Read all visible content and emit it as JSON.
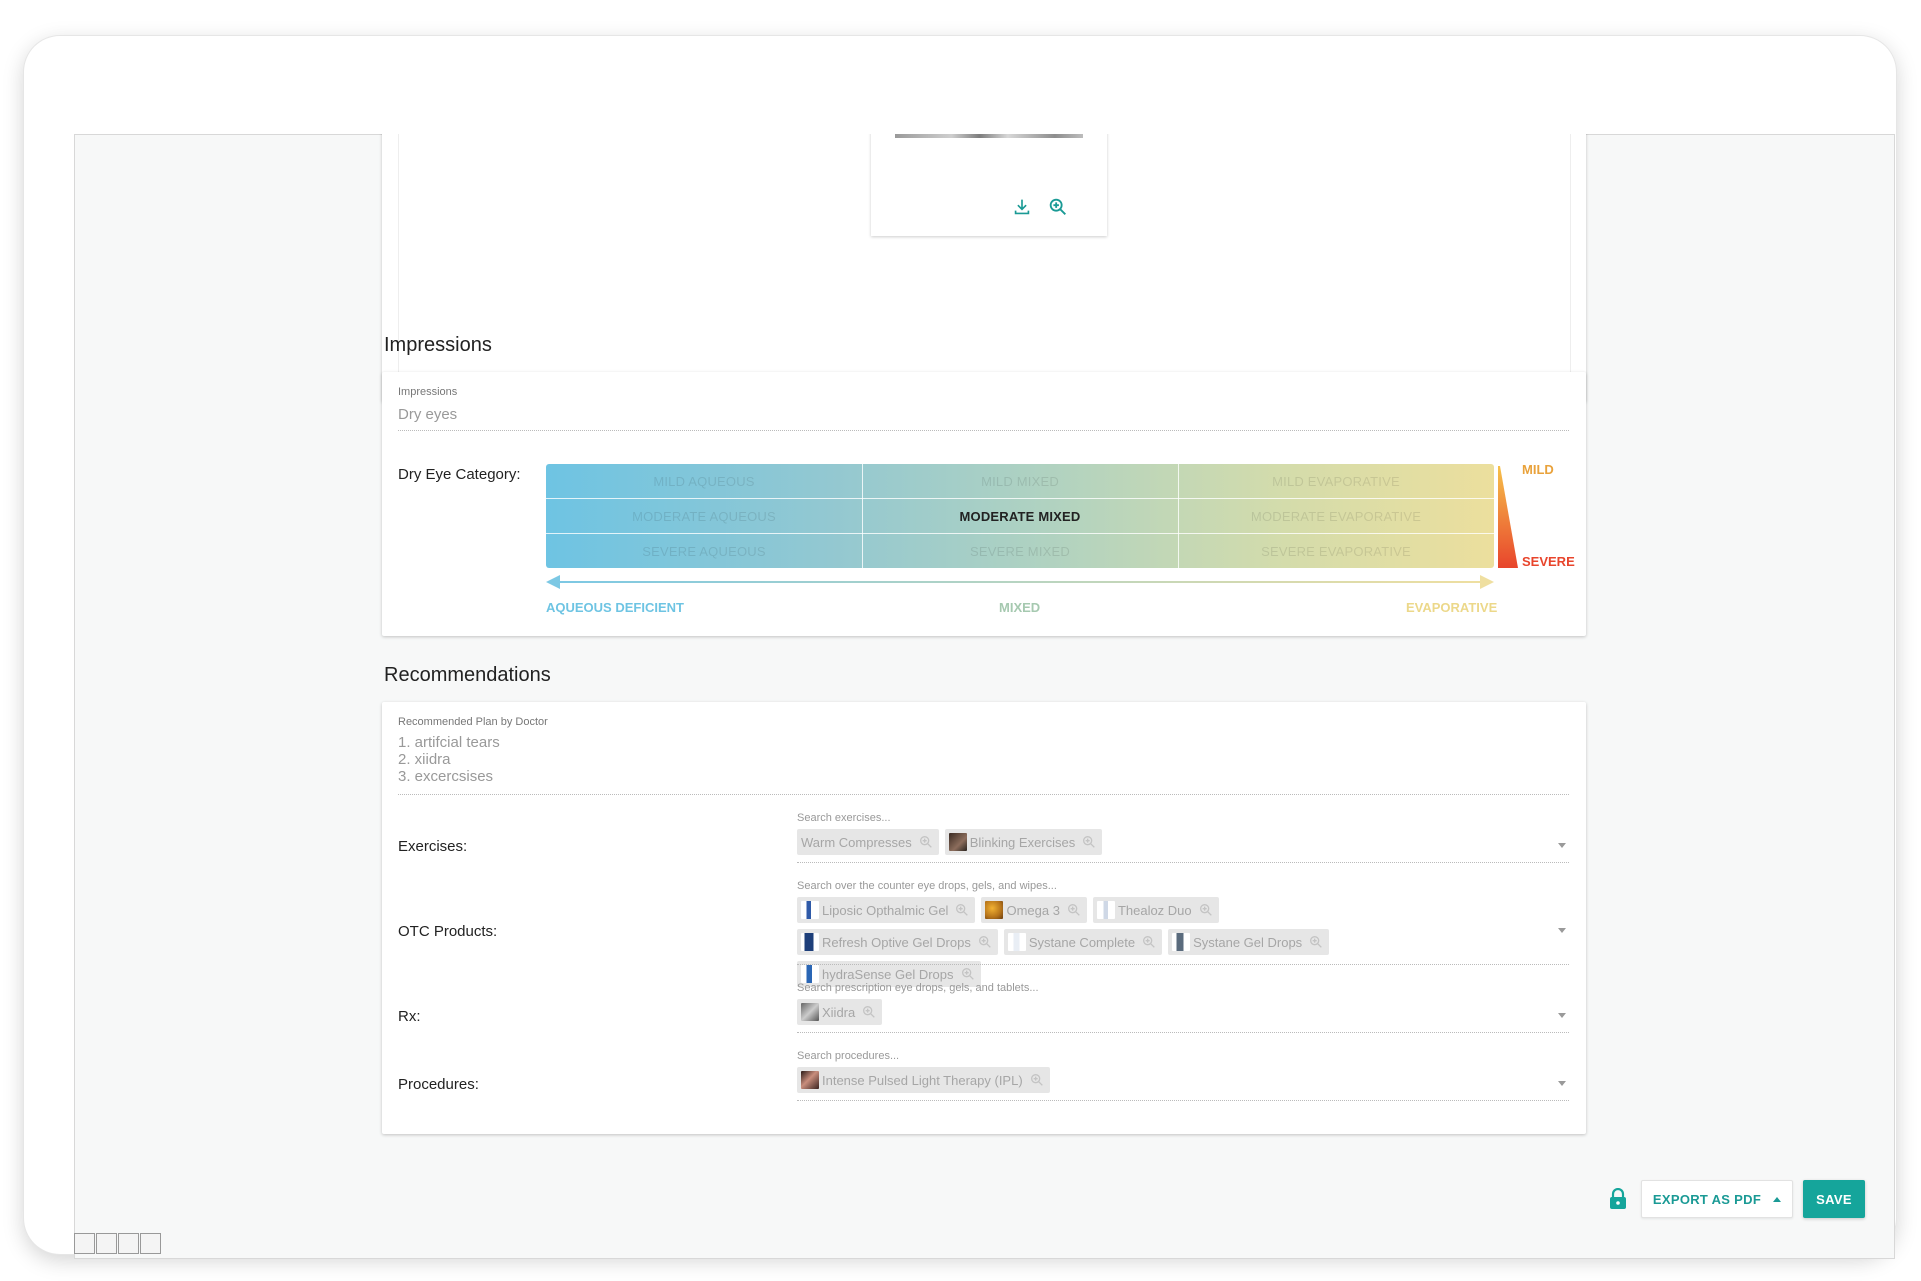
{
  "impressions": {
    "section_title": "Impressions",
    "field_label": "Impressions",
    "field_value": "Dry eyes",
    "category_label": "Dry Eye Category:",
    "grid": {
      "rows": [
        [
          "MILD AQUEOUS",
          "MILD MIXED",
          "MILD EVAPORATIVE"
        ],
        [
          "MODERATE AQUEOUS",
          "MODERATE MIXED",
          "MODERATE EVAPORATIVE"
        ],
        [
          "SEVERE AQUEOUS",
          "SEVERE MIXED",
          "SEVERE EVAPORATIVE"
        ]
      ],
      "selected": "MODERATE MIXED"
    },
    "axis": {
      "left": "AQUEOUS DEFICIENT",
      "middle": "MIXED",
      "right": "EVAPORATIVE"
    },
    "severity": {
      "top": "MILD",
      "bottom": "SEVERE"
    }
  },
  "recommendations": {
    "section_title": "Recommendations",
    "plan_label": "Recommended Plan by Doctor",
    "plan_lines": [
      "1. artifcial tears",
      "2. xiidra",
      "3. excercsises"
    ],
    "exercises": {
      "label": "Exercises:",
      "placeholder": "Search exercises...",
      "chips": [
        "Warm Compresses",
        "Blinking Exercises"
      ]
    },
    "otc": {
      "label": "OTC Products:",
      "placeholder": "Search over the counter eye drops, gels, and wipes...",
      "chips": [
        "Liposic Opthalmic Gel",
        "Omega 3",
        "Thealoz Duo",
        "Refresh Optive Gel Drops",
        "Systane Complete",
        "Systane Gel Drops",
        "hydraSense Gel Drops"
      ]
    },
    "rx": {
      "label": "Rx:",
      "placeholder": "Search prescription eye drops, gels, and tablets...",
      "chips": [
        "Xiidra"
      ]
    },
    "procedures": {
      "label": "Procedures:",
      "placeholder": "Search procedures...",
      "chips": [
        "Intense Pulsed Light Therapy (IPL)"
      ]
    }
  },
  "footer": {
    "export_label": "EXPORT AS PDF",
    "save_label": "SAVE"
  },
  "colors": {
    "accent": "#15a59b",
    "mild": "#e9a23b",
    "severe": "#e8452c",
    "aqueous": "#6ec4e3",
    "mixed": "#a6c9b0",
    "evaporative": "#ecd88a"
  },
  "icons": {
    "download": "download-icon",
    "zoom": "zoom-in-icon",
    "lock": "lock-icon"
  }
}
